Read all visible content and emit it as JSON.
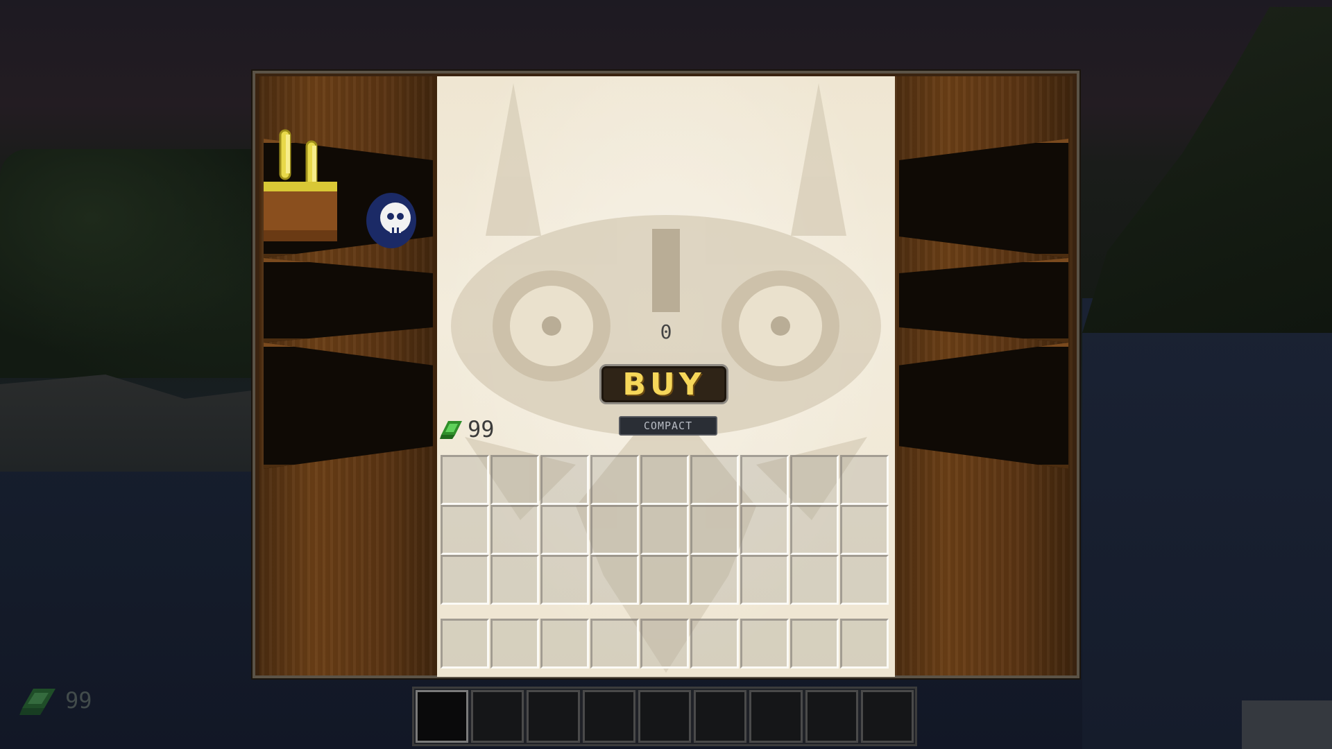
{
  "hud": {
    "rupee_icon": "green-rupee-icon",
    "rupee_count": "99",
    "hotbar_slots": 9,
    "selected_hotbar_slot": 1
  },
  "shop": {
    "price": "0",
    "buy_label": "BUY",
    "compact_label": "COMPACT",
    "wallet_icon": "green-rupee-icon",
    "wallet_count": "99",
    "shelf_items": [
      "bunny-hood-icon",
      "bombchu-icon"
    ],
    "inventory_rows": 3,
    "inventory_columns": 9,
    "hotbar_columns": 9
  },
  "colors": {
    "wood": "#6b3f16",
    "paper": "#efe6d2",
    "buy_text": "#f6d75a",
    "rupee": "#3fae3a"
  }
}
